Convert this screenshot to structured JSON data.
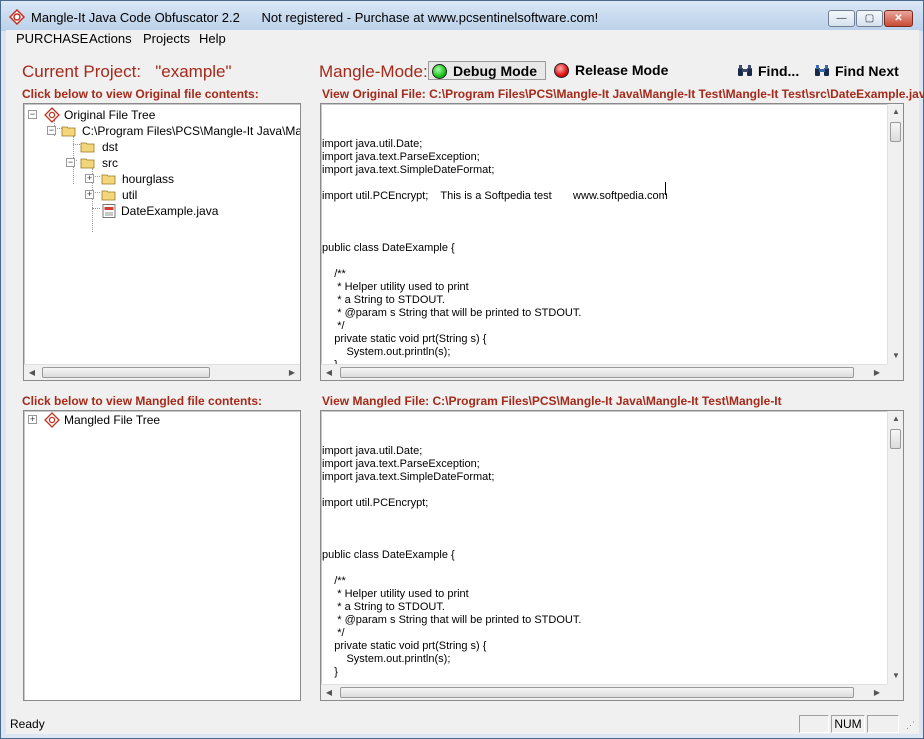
{
  "window": {
    "title": "Mangle-It Java Code Obfuscator 2.2      Not registered - Purchase at www.pcsentinelsoftware.com!",
    "minimize_label": "—",
    "maximize_label": "▢",
    "close_label": "✕"
  },
  "menu": {
    "items": [
      "PURCHASE",
      "Actions",
      "Projects",
      "Help"
    ]
  },
  "toolbar": {
    "current_project_label": "Current Project:   \"example\"",
    "mangle_mode_label": "Mangle-Mode:",
    "debug_mode_label": "Debug Mode",
    "release_mode_label": "Release Mode",
    "find_label": "Find...",
    "find_next_label": "Find Next"
  },
  "original": {
    "tree_caption": "Click below to view Original file contents:",
    "file_caption": "View Original File: C:\\Program Files\\PCS\\Mangle-It Java\\Mangle-It Test\\Mangle-It Test\\src\\DateExample.java",
    "tree": {
      "root": "Original File Tree",
      "path": "C:\\Program Files\\PCS\\Mangle-It Java\\Mangle",
      "dst": "dst",
      "src": "src",
      "hourglass": "hourglass",
      "util": "util",
      "file": "DateExample.java"
    },
    "code": "\n\nimport java.util.Date;\nimport java.text.ParseException;\nimport java.text.SimpleDateFormat;\n\nimport util.PCEncrypt;    This is a Softpedia test       www.softpedia.com\n\n\n\npublic class DateExample {\n\n    /**\n     * Helper utility used to print\n     * a String to STDOUT.\n     * @param s String that will be printed to STDOUT.\n     */\n    private static void prt(String s) {\n        System.out.println(s);\n    }"
  },
  "mangled": {
    "tree_caption": "Click below to view Mangled file contents:",
    "file_caption": "View Mangled File: C:\\Program Files\\PCS\\Mangle-It Java\\Mangle-It Test\\Mangle-It",
    "tree": {
      "root": "Mangled File Tree"
    },
    "code": "\n\nimport java.util.Date;\nimport java.text.ParseException;\nimport java.text.SimpleDateFormat;\n\nimport util.PCEncrypt;\n\n\n\npublic class DateExample {\n\n    /**\n     * Helper utility used to print\n     * a String to STDOUT.\n     * @param s String that will be printed to STDOUT.\n     */\n    private static void prt(String s) {\n        System.out.println(s);\n    }"
  },
  "status": {
    "text": "Ready",
    "num": "NUM"
  },
  "icons": {
    "app": "app-logo-icon",
    "tree_root": "tree-root-icon",
    "folder": "folder-icon",
    "java_file": "java-file-icon",
    "binoculars": "binoculars-icon"
  },
  "colors": {
    "label_red": "#a52a1a",
    "debug_green": "#18c218",
    "release_red": "#e01010"
  }
}
